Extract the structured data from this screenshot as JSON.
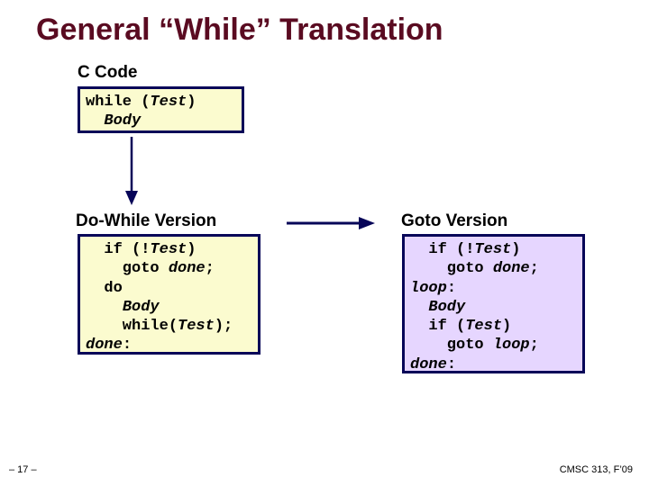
{
  "title": "General “While” Translation",
  "ccode": {
    "heading": "C Code",
    "line1a": "while (",
    "line1b": "Test",
    "line1c": ")",
    "body": "Body"
  },
  "dowhile": {
    "heading": "Do-While Version",
    "l1a": "  if (!",
    "l1b": "Test",
    "l1c": ")",
    "l2a": "    goto ",
    "l2b": "done",
    "l2c": ";",
    "l3": "  do",
    "l4": "Body",
    "l5a": "    while(",
    "l5b": "Test",
    "l5c": ");",
    "l6a": "done",
    "l6b": ":"
  },
  "goto": {
    "heading": "Goto Version",
    "l1a": "  if (!",
    "l1b": "Test",
    "l1c": ")",
    "l2a": "    goto ",
    "l2b": "done",
    "l2c": ";",
    "l3a": "loop",
    "l3b": ":",
    "l4": "Body",
    "l5a": "  if (",
    "l5b": "Test",
    "l5c": ")",
    "l6a": "    goto ",
    "l6b": "loop",
    "l6c": ";",
    "l7a": "done",
    "l7b": ":"
  },
  "footer": {
    "page": "– 17 –",
    "course": "CMSC 313, F’09"
  }
}
